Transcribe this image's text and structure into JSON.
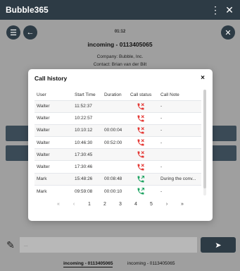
{
  "titlebar": {
    "title": "Bubble365",
    "more_glyph": "⋮",
    "close_glyph": "✕"
  },
  "app": {
    "timer": "01:12",
    "call_title": "incoming - 0113405065",
    "company": "Company: Bubble, Inc.",
    "contact": "Contact: Brian van der Bilt",
    "menu_glyph": "☰",
    "back_glyph": "←",
    "close_glyph": "✕"
  },
  "composer": {
    "placeholder": "...",
    "send_glyph": "➤",
    "edit_glyph": "✎"
  },
  "tabs": [
    {
      "label": "incoming - 0113405065"
    },
    {
      "label": "incoming - 0113405065"
    }
  ],
  "modal": {
    "title": "Call history",
    "close_glyph": "×",
    "columns": [
      "User",
      "Start Time",
      "Duration",
      "Call status",
      "Call Note"
    ],
    "rows": [
      {
        "user": "Walter",
        "start": "11:52:37",
        "duration": "",
        "status": "missed",
        "note": "-"
      },
      {
        "user": "Walter",
        "start": "10:22:57",
        "duration": "",
        "status": "missed",
        "note": "-"
      },
      {
        "user": "Walter",
        "start": "10:10:12",
        "duration": "00:00:04",
        "status": "missed",
        "note": "-"
      },
      {
        "user": "Walter",
        "start": "10:46:30",
        "duration": "00:52:00",
        "status": "missed",
        "note": "-"
      },
      {
        "user": "Walter",
        "start": "17:30:45",
        "duration": "",
        "status": "missed",
        "note": ""
      },
      {
        "user": "Walter",
        "start": "17:30:46",
        "duration": "",
        "status": "missed",
        "note": "-"
      },
      {
        "user": "Mark",
        "start": "15:48:26",
        "duration": "00:08:48",
        "status": "answered",
        "note": "During the conv..."
      },
      {
        "user": "Mark",
        "start": "09:59:08",
        "duration": "00:00:10",
        "status": "answered",
        "note": "-"
      }
    ],
    "pager": {
      "first": "«",
      "prev": "‹",
      "pages": [
        "1",
        "2",
        "3",
        "4",
        "5"
      ],
      "next": "›",
      "last": "»"
    }
  },
  "colors": {
    "answered": "#1fa463",
    "missed": "#e53935",
    "dark": "#2d3b45"
  }
}
